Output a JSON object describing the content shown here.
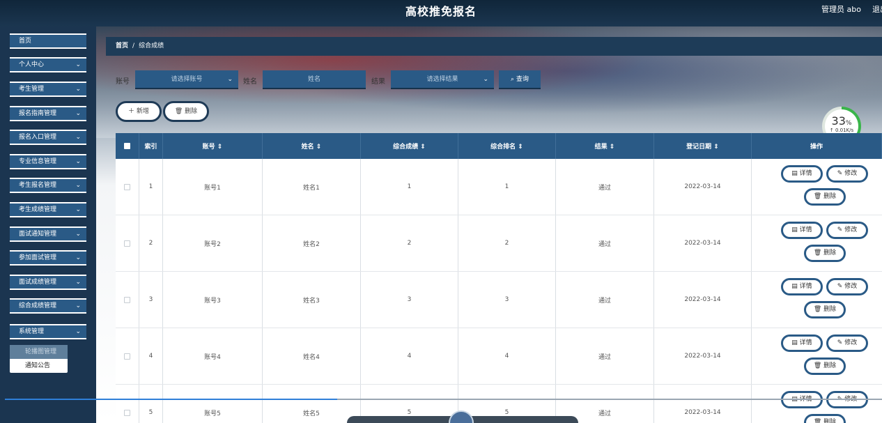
{
  "header": {
    "title": "高校推免报名",
    "user": "管理员 abo",
    "logout": "退出"
  },
  "sidebar": {
    "items": [
      {
        "label": "首页",
        "chev": ""
      },
      {
        "label": "个人中心",
        "chev": "⌄"
      },
      {
        "label": "考生管理",
        "chev": "⌄"
      },
      {
        "label": "报名指南管理",
        "chev": "⌄"
      },
      {
        "label": "报名入口管理",
        "chev": "⌄"
      },
      {
        "label": "专业信息管理",
        "chev": "⌄"
      },
      {
        "label": "考生报名管理",
        "chev": "⌄"
      },
      {
        "label": "考生成绩管理",
        "chev": "⌄"
      },
      {
        "label": "面试通知管理",
        "chev": "⌄"
      },
      {
        "label": "参加面试管理",
        "chev": "⌄"
      },
      {
        "label": "面试成绩管理",
        "chev": "⌄"
      },
      {
        "label": "综合成绩管理",
        "chev": "⌄"
      },
      {
        "label": "系统管理",
        "chev": "⌄"
      }
    ],
    "submenu": [
      "轮播图管理",
      "通知公告"
    ]
  },
  "breadcrumb": {
    "home": "首页",
    "sep": "/",
    "current": "综合成绩"
  },
  "filters": {
    "account_label": "账号",
    "account_placeholder": "请选择账号",
    "name_label": "姓名",
    "name_placeholder": "姓名",
    "result_label": "结果",
    "result_placeholder": "请选择结果",
    "query_label": "查询"
  },
  "actions": {
    "add": "新增",
    "delete": "删除"
  },
  "badge": {
    "percent": "33",
    "unit": "%",
    "speed": "0.01K/s"
  },
  "table": {
    "headers": [
      "索引",
      "账号 ⇕",
      "姓名 ⇕",
      "综合成绩 ⇕",
      "综合排名 ⇕",
      "结果 ⇕",
      "登记日期 ⇕",
      "操作"
    ],
    "rows": [
      [
        "1",
        "账号1",
        "姓名1",
        "1",
        "1",
        "通过",
        "2022-03-14"
      ],
      [
        "2",
        "账号2",
        "姓名2",
        "2",
        "2",
        "通过",
        "2022-03-14"
      ],
      [
        "3",
        "账号3",
        "姓名3",
        "3",
        "3",
        "通过",
        "2022-03-14"
      ],
      [
        "4",
        "账号4",
        "姓名4",
        "4",
        "4",
        "通过",
        "2022-03-14"
      ],
      [
        "5",
        "账号5",
        "姓名5",
        "5",
        "5",
        "通过",
        "2022-03-14"
      ]
    ],
    "row_actions": {
      "detail": "详情",
      "edit": "修改",
      "delete": "删除"
    }
  }
}
